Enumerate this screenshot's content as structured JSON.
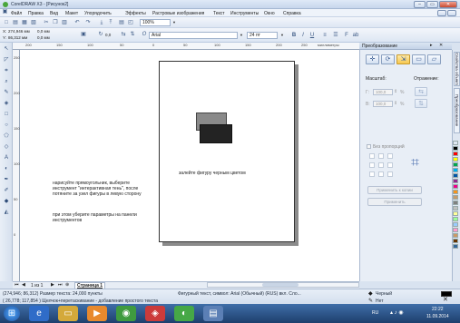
{
  "window": {
    "title": "CorelDRAW X3 - [Рисунок2]",
    "minimize": "–",
    "restore": "▭",
    "close": "✕"
  },
  "menu": [
    {
      "label": "Файл"
    },
    {
      "label": "Правка"
    },
    {
      "label": "Вид"
    },
    {
      "label": "Макет"
    },
    {
      "label": "Упорядочить"
    },
    {
      "label": "Эффекты"
    },
    {
      "label": "Растровые изображения"
    },
    {
      "label": "Текст"
    },
    {
      "label": "Инструменты"
    },
    {
      "label": "Окно"
    },
    {
      "label": "Справка"
    }
  ],
  "toolbar": {
    "zoom_value": "100%"
  },
  "propertybar": {
    "x_pos": "274,946 мм",
    "y_pos": "86,312 мм",
    "width": "0,0 мм",
    "height": "0,0 мм",
    "angle": "0,0",
    "font_name": "Arial",
    "font_size": "24 пт"
  },
  "ruler": {
    "h_ticks": [
      "200",
      "150",
      "100",
      "50",
      "0",
      "50",
      "100",
      "150",
      "200",
      "250",
      "300"
    ],
    "h_unit": "миллиметры",
    "v_ticks": [
      "250",
      "200",
      "150",
      "100",
      "50",
      "0"
    ]
  },
  "canvas": {
    "page_caption": "залейте фигуру черным цветом",
    "instruction_1": "нарисуйте прямоугольник, выберите инструмент \"интерактивная тень\", после потяните за узел фигуры в левую сторону",
    "instruction_2": "при этом уберите параметры на панели инструментов"
  },
  "docker": {
    "title": "Преобразование",
    "scale_label": "Масштаб:",
    "mirror_label": "Отражение:",
    "x_label": "Г:",
    "y_label": "В:",
    "x_value": "100,0",
    "y_value": "100,0",
    "unit": "%",
    "nonproportional": "Без пропорций",
    "apply_copy": "Применить к копии",
    "apply": "Применить"
  },
  "side_tabs": [
    "Свойства объекта",
    "Преобразование"
  ],
  "palette": [
    "#ffffff",
    "#000000",
    "#ff0000",
    "#ffff00",
    "#00a650",
    "#00aeef",
    "#0054a6",
    "#92278f",
    "#ed008c",
    "#f7941d",
    "#c69c6d",
    "#808080",
    "#c0c0c0",
    "#ffff99",
    "#99ff99",
    "#99ccff",
    "#ff99cc",
    "#cc9966",
    "#663300",
    "#336699"
  ],
  "pagenav": {
    "page_count": "1 из 1",
    "page_tab": "Страница 1"
  },
  "status": {
    "line1": "(274,946; 86,312)  Размер текста: 24,000 пункты",
    "line1_mid": "Фигурный текст, символ: Arial (Обычный) (RUS) вкл. Сло...",
    "fill": "Черный",
    "line2": "( 26,778; 117,854 )    Щелчок+перетаскивание - добавление простого текста",
    "outline": "Нет"
  },
  "taskbar": {
    "lang": "RU",
    "time": "22:22",
    "date": "11.09.2014"
  }
}
